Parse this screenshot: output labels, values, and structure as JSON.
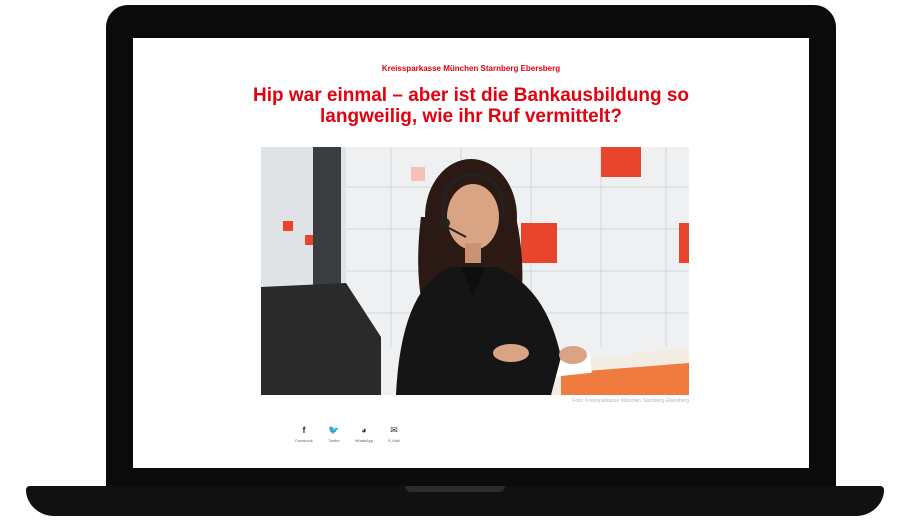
{
  "page": {
    "kicker": "Kreissparkasse München Starnberg Ebersberg",
    "headline": "Hip war einmal – aber ist die Bankausbildung so langweilig, wie ihr Ruf vermittelt?",
    "image_caption": "Foto: Kreissparkasse München Starnberg Ebersberg",
    "accent_color": "#e3000f"
  },
  "share": {
    "items": [
      {
        "label": "Facebook",
        "icon": "facebook-icon",
        "glyph": "f"
      },
      {
        "label": "Twitter",
        "icon": "twitter-icon",
        "glyph": "🐦"
      },
      {
        "label": "WhatsApp",
        "icon": "whatsapp-icon",
        "glyph": "◕"
      },
      {
        "label": "E-Mail",
        "icon": "mail-icon",
        "glyph": "✉"
      }
    ]
  }
}
